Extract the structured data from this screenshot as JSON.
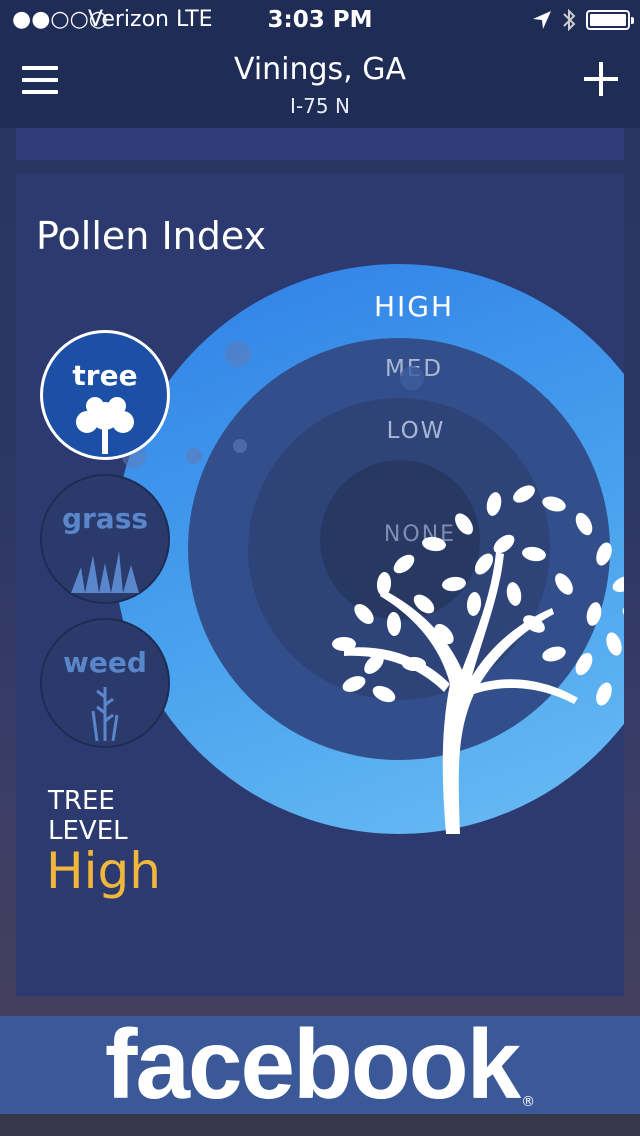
{
  "status_bar": {
    "signal": "●●○○○",
    "carrier": "Verizon  LTE",
    "time": "3:03 PM",
    "icons": [
      "location-arrow-icon",
      "bluetooth-icon",
      "battery-icon"
    ]
  },
  "header": {
    "title": "Vinings, GA",
    "subtitle": "I-75 N",
    "menu_icon": "hamburger-menu-icon",
    "add_icon": "plus-icon"
  },
  "pollen": {
    "title": "Pollen Index",
    "levels": [
      "HIGH",
      "MED",
      "LOW",
      "NONE"
    ],
    "types": [
      {
        "label": "tree",
        "selected": true
      },
      {
        "label": "grass",
        "selected": false
      },
      {
        "label": "weed",
        "selected": false
      }
    ],
    "level_label_line1": "TREE",
    "level_label_line2": "LEVEL",
    "level_value": "High",
    "colors": {
      "high_value": "#f0b73a",
      "selected_button": "#1c4fa6",
      "ring_high": "#3b8ee9"
    }
  },
  "banner": {
    "text": "facebook",
    "reg": "®",
    "color": "#3b5998"
  }
}
